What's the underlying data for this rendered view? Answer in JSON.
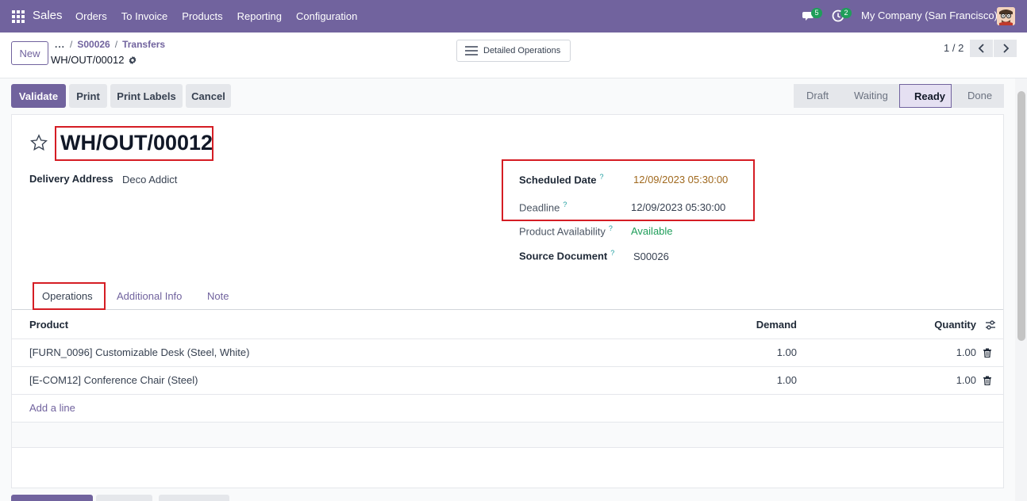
{
  "navbar": {
    "app_name": "Sales",
    "menu": [
      "Orders",
      "To Invoice",
      "Products",
      "Reporting",
      "Configuration"
    ],
    "messages_badge": "5",
    "activities_badge": "2",
    "company": "My Company (San Francisco)"
  },
  "control_panel": {
    "new_label": "New",
    "breadcrumb": [
      "...",
      "S00026",
      "Transfers"
    ],
    "record_name": "WH/OUT/00012",
    "detailed_operations_label": "Detailed Operations",
    "pager": "1 / 2"
  },
  "actions": {
    "validate": "Validate",
    "print": "Print",
    "print_labels": "Print Labels",
    "cancel": "Cancel"
  },
  "status": {
    "stages": [
      "Draft",
      "Waiting",
      "Ready",
      "Done"
    ],
    "current": "Ready"
  },
  "form": {
    "title": "WH/OUT/00012",
    "delivery_address_label": "Delivery Address",
    "delivery_address": "Deco Addict",
    "scheduled_date_label": "Scheduled Date",
    "scheduled_date": "12/09/2023 05:30:00",
    "deadline_label": "Deadline",
    "deadline": "12/09/2023 05:30:00",
    "availability_label": "Product Availability",
    "availability": "Available",
    "source_document_label": "Source Document",
    "source_document": "S00026",
    "help_mark": "?"
  },
  "tabs": [
    "Operations",
    "Additional Info",
    "Note"
  ],
  "table": {
    "headers": {
      "product": "Product",
      "demand": "Demand",
      "quantity": "Quantity"
    },
    "rows": [
      {
        "product": "[FURN_0096] Customizable Desk (Steel, White)",
        "demand": "1.00",
        "quantity": "1.00"
      },
      {
        "product": "[E-COM12] Conference Chair (Steel)",
        "demand": "1.00",
        "quantity": "1.00"
      }
    ],
    "add_line": "Add a line"
  },
  "colors": {
    "brand": "#71639e",
    "highlight": "#d51d24",
    "available": "#1f9e5a",
    "date_warning": "#a0691e"
  }
}
